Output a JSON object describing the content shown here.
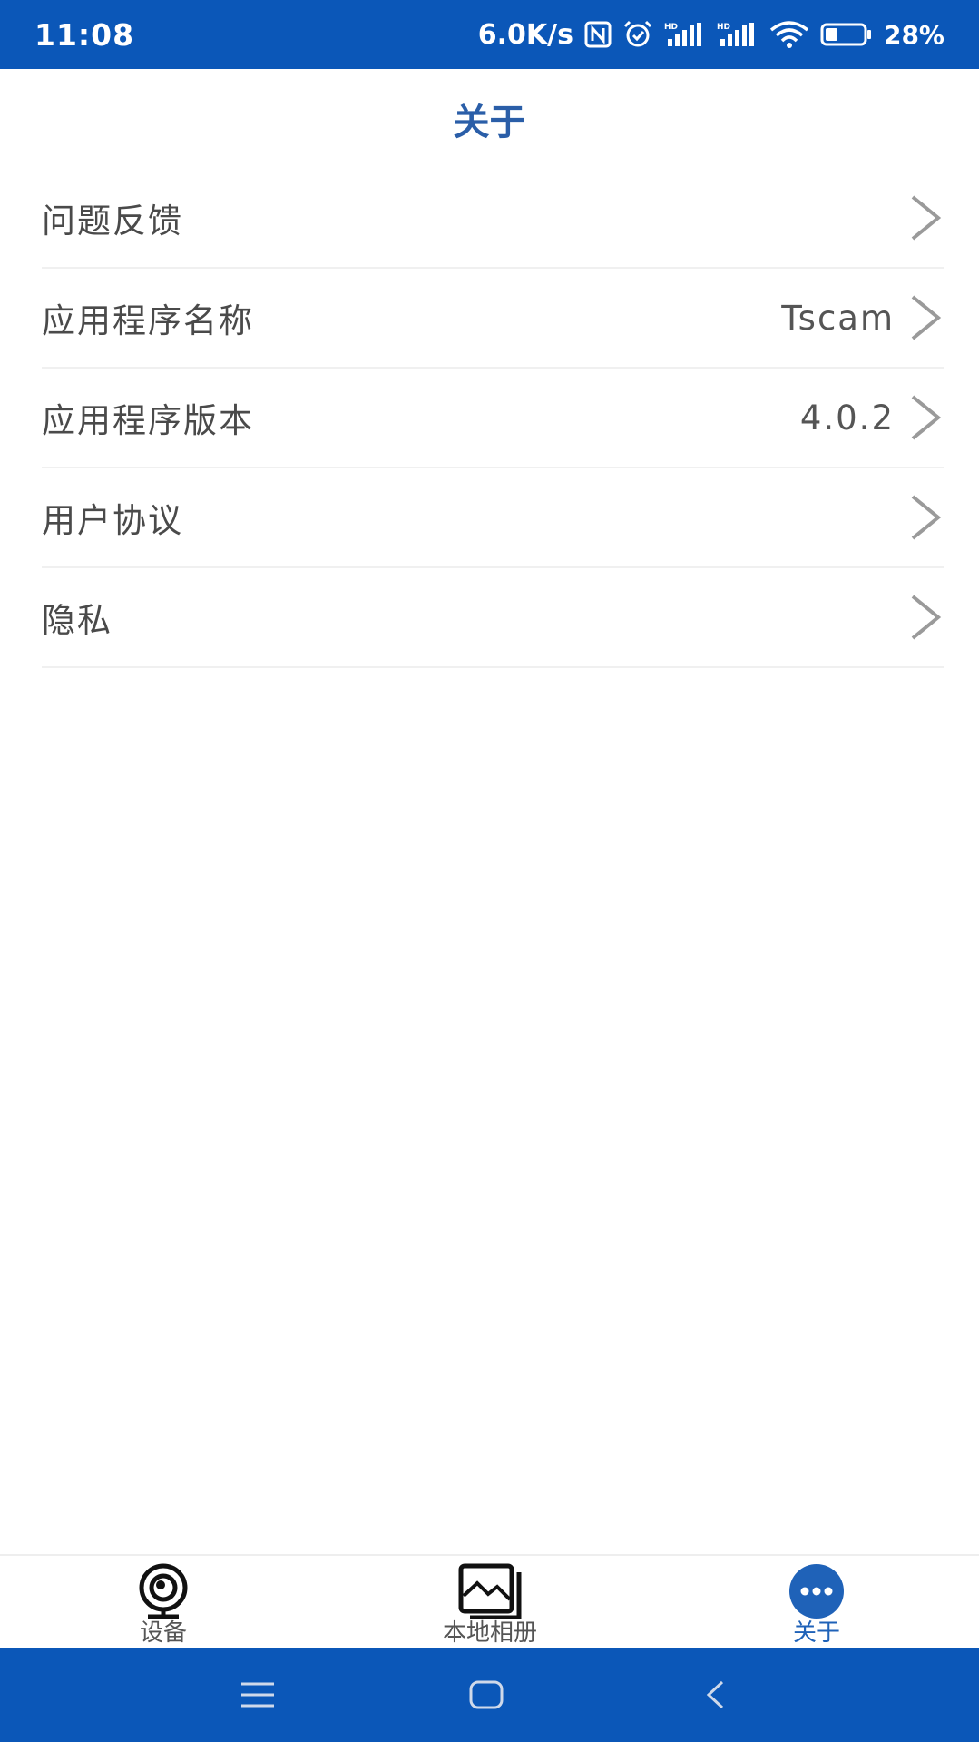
{
  "status_bar": {
    "time": "11:08",
    "net_speed": "6.0K/s",
    "battery_percent": "28%"
  },
  "page": {
    "title": "关于"
  },
  "menu": {
    "items": [
      {
        "label": "问题反馈",
        "value": ""
      },
      {
        "label": "应用程序名称",
        "value": "Tscam"
      },
      {
        "label": "应用程序版本",
        "value": "4.0.2"
      },
      {
        "label": "用户协议",
        "value": ""
      },
      {
        "label": "隐私",
        "value": ""
      }
    ]
  },
  "tabs": [
    {
      "label": "设备",
      "icon": "camera-icon",
      "active": false
    },
    {
      "label": "本地相册",
      "icon": "gallery-icon",
      "active": false
    },
    {
      "label": "关于",
      "icon": "more-icon",
      "active": true
    }
  ],
  "colors": {
    "bar_blue": "#0b57b8",
    "title_blue": "#2a5ea8",
    "active_tab": "#1f62b8"
  }
}
